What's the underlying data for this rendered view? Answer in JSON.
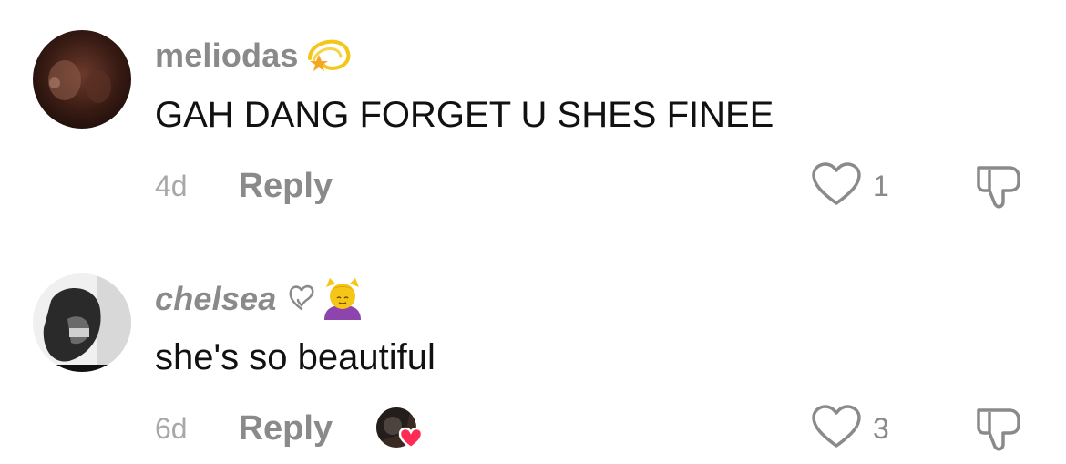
{
  "comments": [
    {
      "username": "meliodas",
      "badge_icon": "dizzy-star-emoji",
      "text": "GAH DANG FORGET U SHES FINEE",
      "age": "4d",
      "reply_label": "Reply",
      "like_count": "1",
      "creator_liked": false
    },
    {
      "username": "chelsea",
      "badge_icon": "heart-outline-and-face-massage-emoji",
      "text": "she's so beautiful",
      "age": "6d",
      "reply_label": "Reply",
      "like_count": "3",
      "creator_liked": true
    }
  ],
  "colors": {
    "username": "#8a8a8a",
    "text": "#111111",
    "meta": "#a8a8a8",
    "heart_badge": "#fe2c55"
  }
}
